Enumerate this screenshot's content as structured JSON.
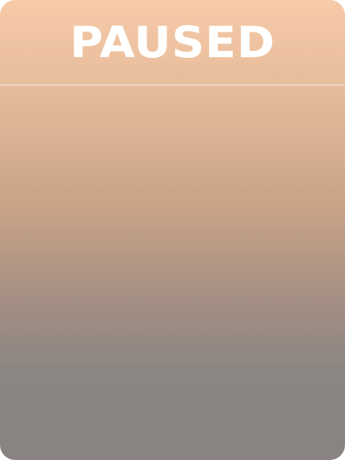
{
  "pause_screen": {
    "title": "PAUSED"
  },
  "colors": {
    "gradient_top": "#f7cba8",
    "gradient_bottom": "#898481",
    "title_color": "#ffffff",
    "divider_color": "#ffffff"
  }
}
